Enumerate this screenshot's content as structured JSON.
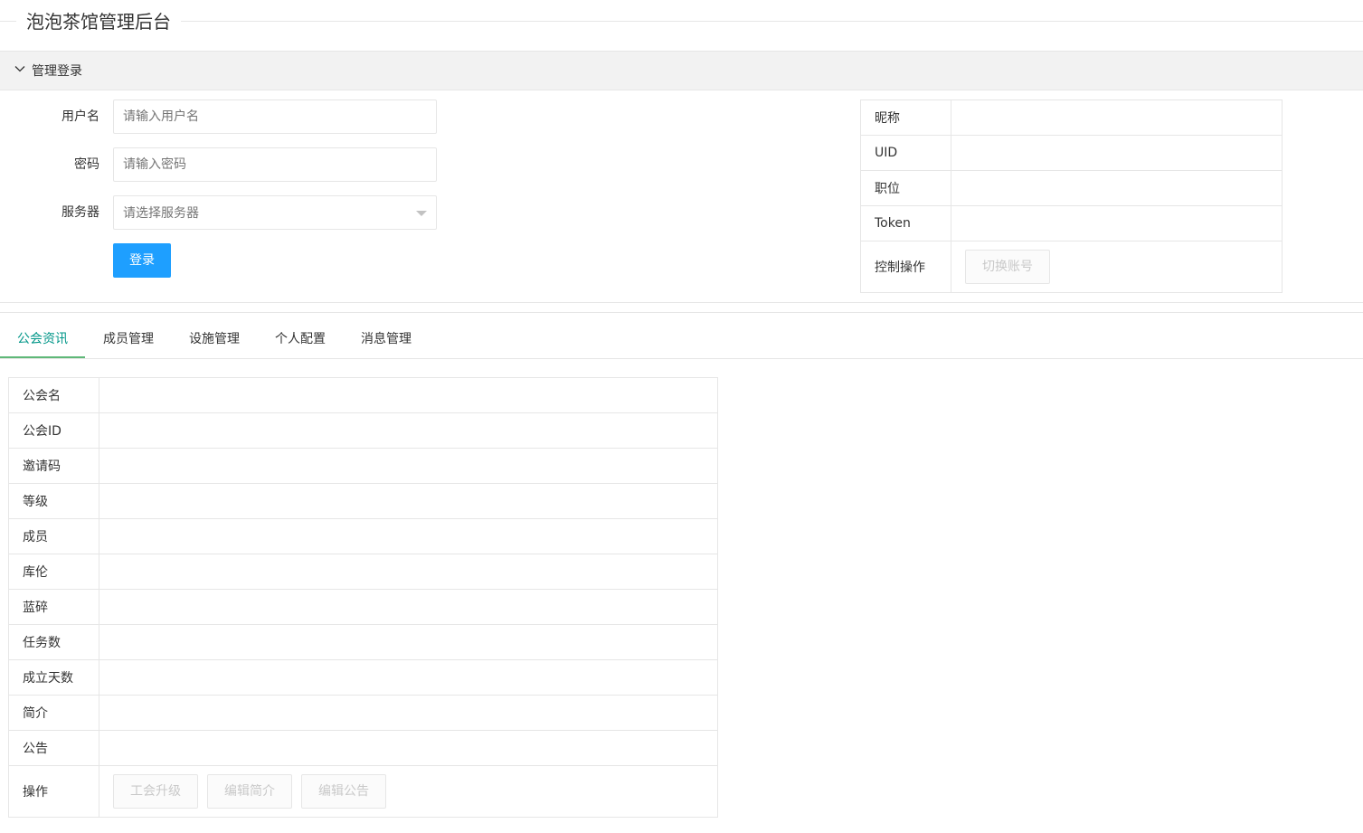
{
  "app": {
    "title": "泡泡茶馆管理后台"
  },
  "login_panel": {
    "header": "管理登录",
    "username": {
      "label": "用户名",
      "placeholder": "请输入用户名"
    },
    "password": {
      "label": "密码",
      "placeholder": "请输入密码"
    },
    "server": {
      "label": "服务器",
      "placeholder": "请选择服务器"
    },
    "submit_label": "登录"
  },
  "account_info": {
    "rows": [
      {
        "key": "昵称",
        "value": ""
      },
      {
        "key": "UID",
        "value": ""
      },
      {
        "key": "职位",
        "value": ""
      },
      {
        "key": "Token",
        "value": ""
      }
    ],
    "control": {
      "key": "控制操作",
      "switch_label": "切换账号"
    }
  },
  "tabs": [
    "公会资讯",
    "成员管理",
    "设施管理",
    "个人配置",
    "消息管理"
  ],
  "guild_info": {
    "rows": [
      {
        "key": "公会名",
        "value": ""
      },
      {
        "key": "公会ID",
        "value": ""
      },
      {
        "key": "邀请码",
        "value": ""
      },
      {
        "key": "等级",
        "value": ""
      },
      {
        "key": "成员",
        "value": ""
      },
      {
        "key": "库伦",
        "value": ""
      },
      {
        "key": "蓝碎",
        "value": ""
      },
      {
        "key": "任务数",
        "value": ""
      },
      {
        "key": "成立天数",
        "value": ""
      },
      {
        "key": "简介",
        "value": ""
      },
      {
        "key": "公告",
        "value": ""
      }
    ],
    "actions": {
      "key": "操作",
      "upgrade_label": "工会升级",
      "edit_intro_label": "编辑简介",
      "edit_notice_label": "编辑公告"
    }
  },
  "colors": {
    "primary_button": "#1e9fff",
    "active_tab": "#009688",
    "tab_indicator": "#5fb878"
  }
}
